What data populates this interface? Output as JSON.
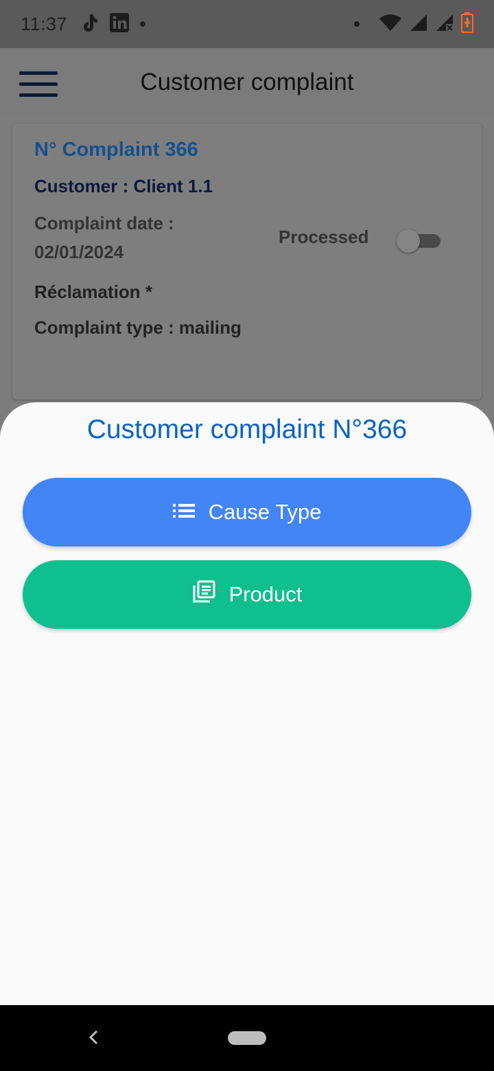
{
  "status_bar": {
    "time": "11:37",
    "left_icons": [
      "tiktok-icon",
      "linkedin-icon",
      "dot-icon"
    ],
    "right_icons": [
      "dot-icon",
      "wifi-icon",
      "signal-icon",
      "signal-no-data-icon",
      "battery-charging-icon"
    ],
    "wifi_badge": "4",
    "battery_color": "#ff6a2b"
  },
  "app_bar": {
    "title": "Customer complaint",
    "menu_icon": "hamburger-menu-icon"
  },
  "complaint_card": {
    "number": "N° Complaint 366",
    "customer": "Customer : Client 1.1",
    "date_label": "Complaint date :",
    "date_value": "02/01/2024",
    "processed_label": "Processed",
    "processed": false,
    "reclamation": "Réclamation *",
    "complaint_type": "Complaint type : mailing"
  },
  "bottom_sheet": {
    "title": "Customer complaint N°366",
    "buttons": [
      {
        "label": "Cause Type",
        "icon": "list-icon",
        "color": "#4285f4"
      },
      {
        "label": "Product",
        "icon": "library-books-icon",
        "color": "#0fbf8f"
      }
    ]
  },
  "nav_bar": {
    "back_icon": "back-chevron-icon",
    "home_icon": "home-pill-icon"
  },
  "colors": {
    "accent_title": "#0a64c4",
    "card_number": "#14508f"
  }
}
